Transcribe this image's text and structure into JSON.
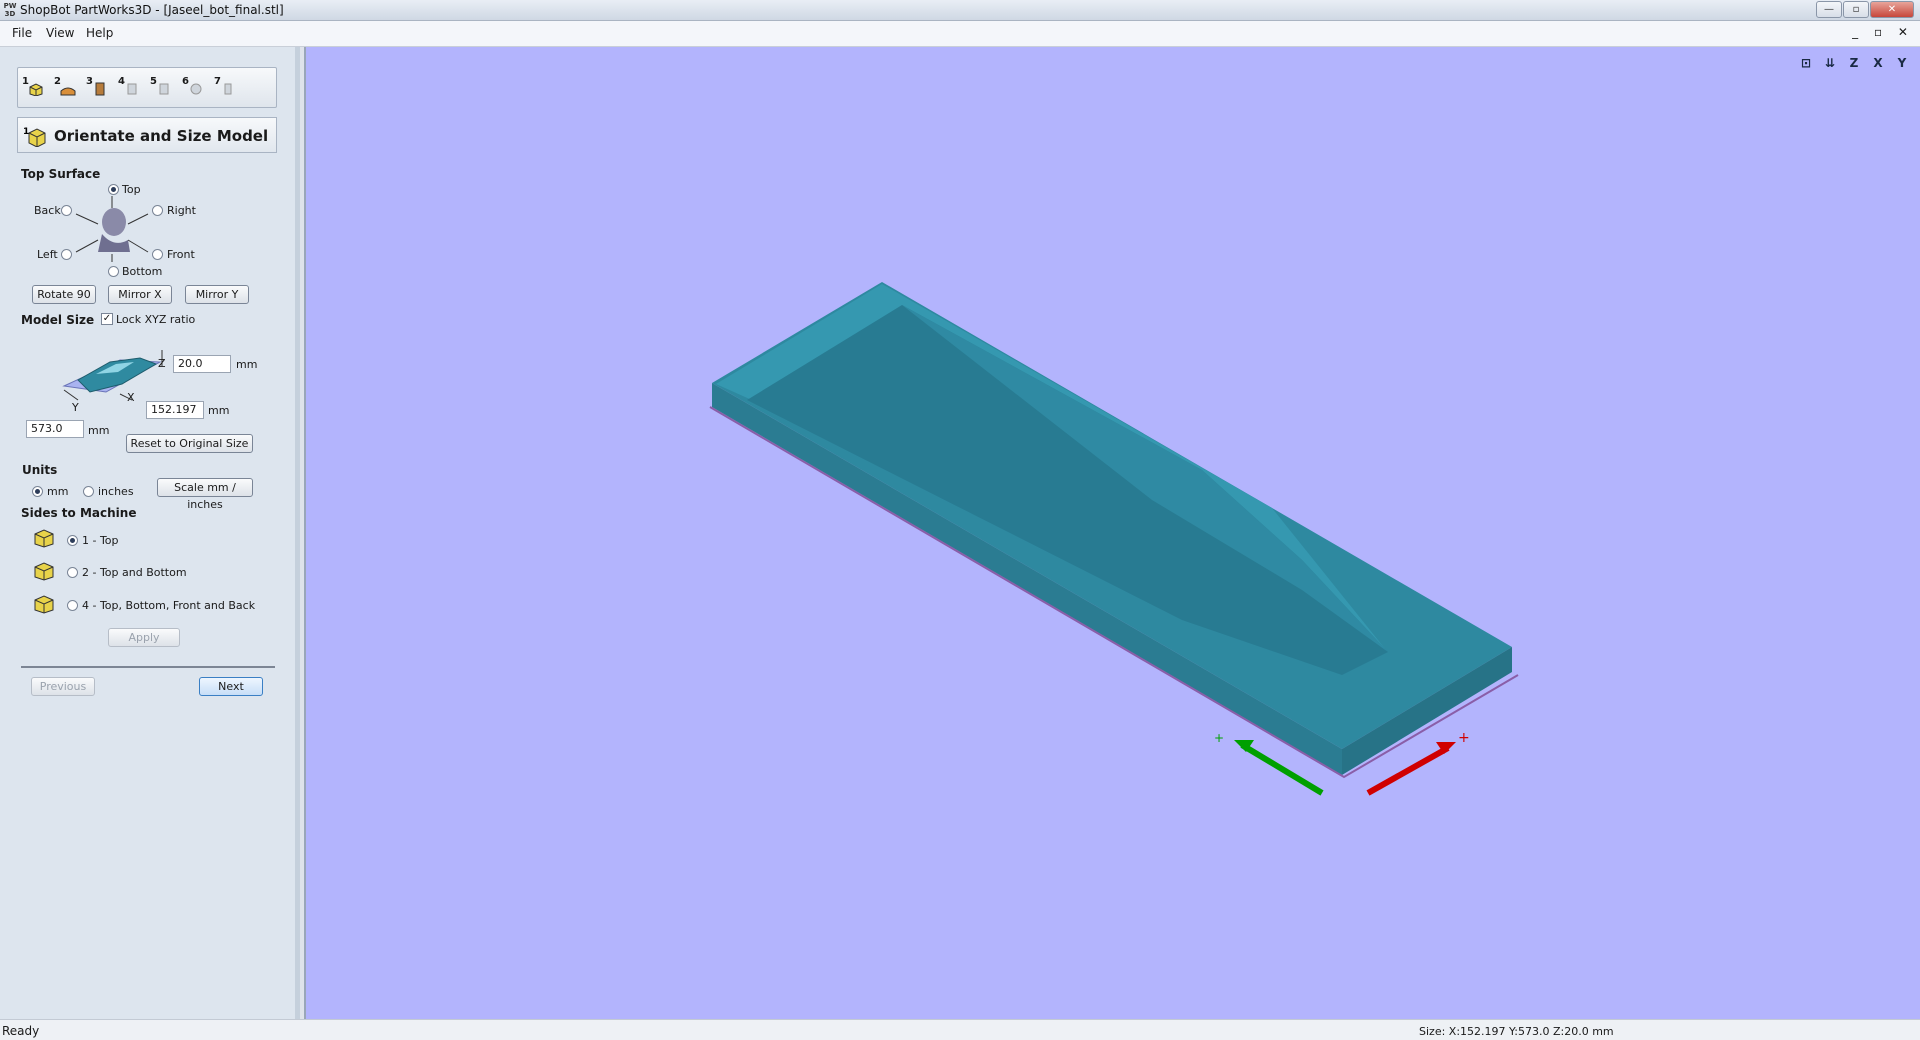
{
  "window": {
    "app_icon": "PW 3D",
    "title": "ShopBot PartWorks3D - [Jaseel_bot_final.stl]",
    "minimize_icon": "minimize-icon",
    "maximize_icon": "maximize-icon",
    "close_icon": "close-icon"
  },
  "menu": {
    "items": [
      "File",
      "View",
      "Help"
    ],
    "doc_controls": "_ ▫ ✕"
  },
  "toolbar": {
    "steps": [
      "1",
      "2",
      "3",
      "4",
      "5",
      "6",
      "7"
    ]
  },
  "panel": {
    "title": "Orientate and Size Model",
    "top_surface": {
      "heading": "Top Surface",
      "options": {
        "top": "Top",
        "back": "Back",
        "right": "Right",
        "left": "Left",
        "front": "Front",
        "bottom": "Bottom"
      },
      "selected": "Top",
      "buttons": {
        "rotate": "Rotate 90",
        "mirror_x": "Mirror X",
        "mirror_y": "Mirror Y"
      }
    },
    "model_size": {
      "heading": "Model Size",
      "lock_label": "Lock XYZ ratio",
      "lock_checked": true,
      "z_value": "20.0",
      "x_value": "152.197",
      "y_value": "573.0",
      "unit": "mm",
      "axis_z": "Z",
      "axis_x": "X",
      "axis_y": "Y",
      "reset_label": "Reset to Original Size"
    },
    "units": {
      "heading": "Units",
      "mm": "mm",
      "inches": "inches",
      "selected": "mm",
      "scale_label": "Scale mm / inches"
    },
    "sides": {
      "heading": "Sides to Machine",
      "options": [
        "1 - Top",
        "2 - Top and Bottom",
        "4 - Top, Bottom, Front and Back"
      ],
      "selected_index": 0,
      "apply_label": "Apply"
    },
    "nav": {
      "previous": "Previous",
      "next": "Next"
    }
  },
  "viewport": {
    "background": "#b3b4fd",
    "model_color": "#2f8aa0",
    "nav_icons": [
      "zoom-fit-icon",
      "view-iso-icon",
      "view-z-icon",
      "view-x-icon",
      "view-y-icon"
    ],
    "nav_labels": [
      "⊡",
      "⇊",
      "Z",
      "X",
      "Y"
    ]
  },
  "status": {
    "ready": "Ready",
    "size": "Size: X:152.197 Y:573.0 Z:20.0 mm"
  },
  "colors": {
    "axis_x": "#d00000",
    "axis_y": "#00a000"
  }
}
